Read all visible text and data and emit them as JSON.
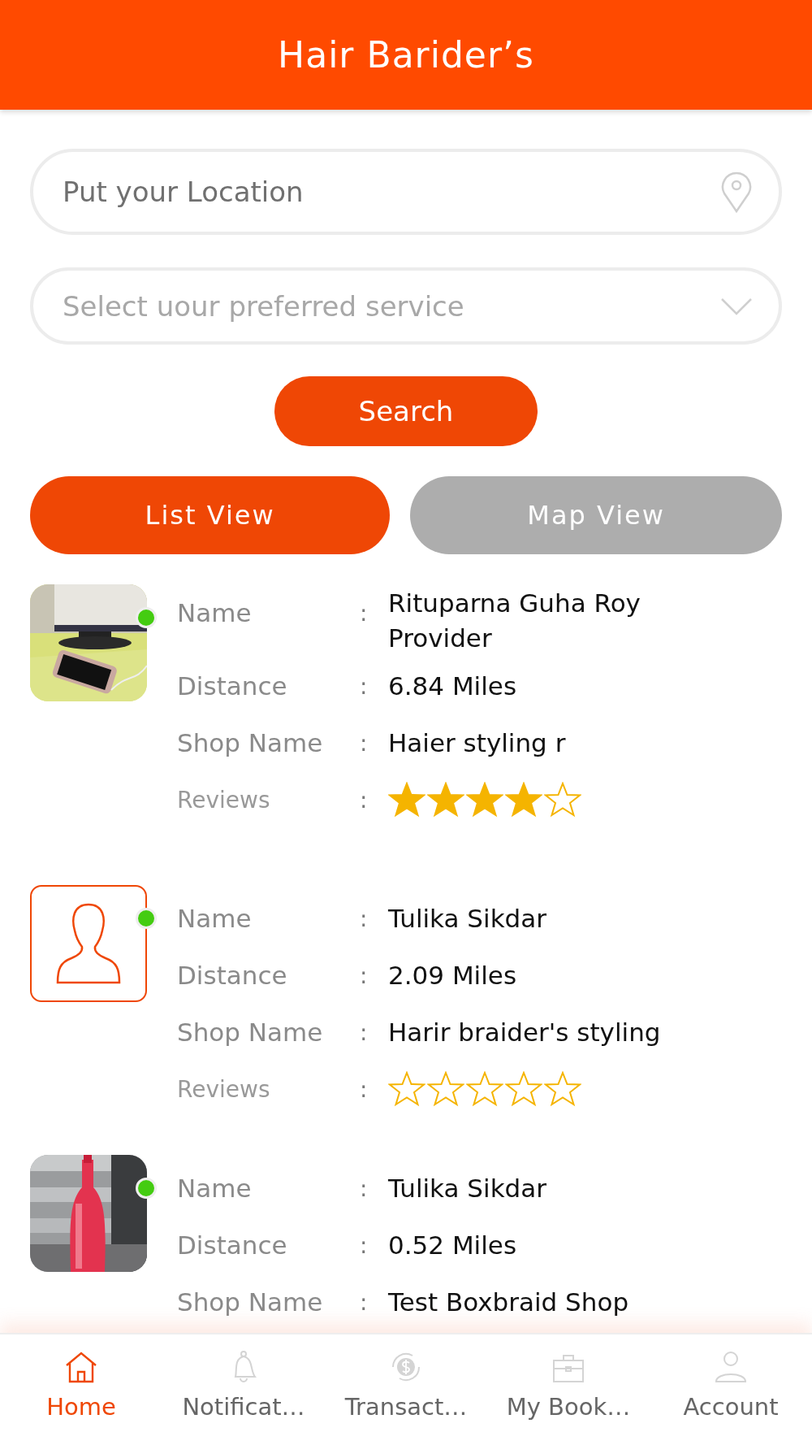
{
  "header": {
    "title": "Hair Barider’s"
  },
  "location_field": {
    "placeholder": "Put your Location"
  },
  "service_dropdown": {
    "placeholder": "Select uour preferred service"
  },
  "search_button": "Search",
  "view_tabs": [
    {
      "label": "List View",
      "selected": true
    },
    {
      "label": "Map View",
      "selected": false
    }
  ],
  "providers": [
    {
      "online": true,
      "rows": [
        {
          "label": "Name",
          "value": "Rituparna Guha Roy Provider"
        },
        {
          "label": "Distance",
          "value": "6.84 Miles"
        },
        {
          "label": "Shop Name",
          "value": "Haier styling r"
        }
      ],
      "reviews_label": "Reviews",
      "stars": 4
    },
    {
      "photo": {
        "kind": "avatar"
      },
      "online": true,
      "rows": [
        {
          "label": "Name",
          "value": "Tulika Sikdar"
        },
        {
          "label": "Distance",
          "value": "2.09 Miles"
        },
        {
          "label": "Shop Name",
          "value": "Harir braider's styling"
        }
      ],
      "reviews_label": "Reviews",
      "stars": 0
    },
    {
      "online": true,
      "rows": [
        {
          "label": "Name",
          "value": "Tulika Sikdar"
        },
        {
          "label": "Distance",
          "value": "0.52 Miles"
        },
        {
          "label": "Shop Name",
          "value": "Test Boxbraid Shop"
        }
      ]
    }
  ],
  "colon": ":",
  "bottom_nav": [
    {
      "label": "Home",
      "selected": true
    },
    {
      "label": "Notificat…",
      "selected": false
    },
    {
      "label": "Transact…",
      "selected": false
    },
    {
      "label": "My Book…",
      "selected": false
    },
    {
      "label": "Account",
      "selected": false
    }
  ]
}
